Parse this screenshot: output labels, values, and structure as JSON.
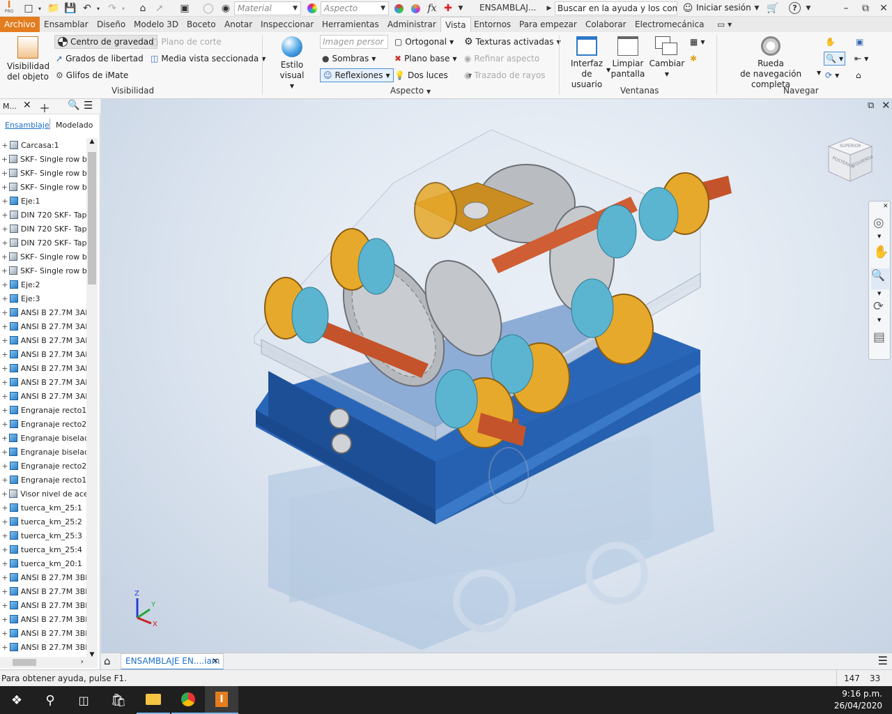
{
  "app": {
    "logo_top": "I",
    "logo_bottom": "PRO",
    "material_placeholder": "Material",
    "appearance_placeholder": "Aspecto",
    "fx": "fx",
    "doc_title": "ENSAMBLAJ...",
    "search_placeholder": "Buscar en la ayuda y los comanc",
    "signin": "Iniciar sesión",
    "help": "?"
  },
  "tabs": [
    "Archivo",
    "Ensamblar",
    "Diseño",
    "Modelo 3D",
    "Boceto",
    "Anotar",
    "Inspeccionar",
    "Herramientas",
    "Administrar",
    "Vista",
    "Entornos",
    "Para empezar",
    "Colaborar",
    "Electromecánica"
  ],
  "active_tab": "Vista",
  "ribbon": {
    "visibility": {
      "object_visibility": "Visibilidad\ndel objeto",
      "center_gravity": "Centro de gravedad",
      "cut_plane": "Plano de corte",
      "dof": "Grados de libertad",
      "half_section": "Media vista seccionada",
      "imate": "Glifos de iMate",
      "label": "Visibilidad"
    },
    "appearance": {
      "visual_style": "Estilo visual",
      "image_persp": "Imagen persor",
      "orthographic": "Ortogonal",
      "textures": "Texturas activadas",
      "shadows": "Sombras",
      "ground_plane": "Plano base",
      "refine": "Refinar aspecto",
      "reflections": "Reflexiones",
      "two_lights": "Dos luces",
      "ray_trace": "Trazado de rayos",
      "label": "Aspecto"
    },
    "windows": {
      "ui": "Interfaz de\nusuario",
      "clean": "Limpiar\npantalla",
      "switch": "Cambiar",
      "label": "Ventanas"
    },
    "navigate": {
      "wheel": "Rueda\nde navegación completa",
      "label": "Navegar"
    }
  },
  "browser": {
    "header": "M...",
    "tab_assembly": "Ensamblaje",
    "tab_modeling": "Modelado",
    "items": [
      {
        "label": "Carcasa:1",
        "type": "asm"
      },
      {
        "label": "SKF- Single row ba",
        "type": "asm"
      },
      {
        "label": "SKF- Single row ba",
        "type": "asm"
      },
      {
        "label": "SKF- Single row ba",
        "type": "asm"
      },
      {
        "label": "Eje:1",
        "type": "part"
      },
      {
        "label": "DIN 720 SKF- Tap",
        "type": "asm"
      },
      {
        "label": "DIN 720 SKF- Tap",
        "type": "asm"
      },
      {
        "label": "DIN 720 SKF- Tap",
        "type": "asm"
      },
      {
        "label": "SKF- Single row ba",
        "type": "asm"
      },
      {
        "label": "SKF- Single row ba",
        "type": "asm"
      },
      {
        "label": "Eje:2",
        "type": "part"
      },
      {
        "label": "Eje:3",
        "type": "part"
      },
      {
        "label": "ANSI B 27.7M 3AI",
        "type": "part"
      },
      {
        "label": "ANSI B 27.7M 3AI",
        "type": "part"
      },
      {
        "label": "ANSI B 27.7M 3AI",
        "type": "part"
      },
      {
        "label": "ANSI B 27.7M 3AI",
        "type": "part"
      },
      {
        "label": "ANSI B 27.7M 3AI",
        "type": "part"
      },
      {
        "label": "ANSI B 27.7M 3AI",
        "type": "part"
      },
      {
        "label": "ANSI B 27.7M 3AI",
        "type": "part"
      },
      {
        "label": "Engranaje recto1",
        "type": "part"
      },
      {
        "label": "Engranaje recto2",
        "type": "part"
      },
      {
        "label": "Engranaje biselad",
        "type": "part"
      },
      {
        "label": "Engranaje biselad",
        "type": "part"
      },
      {
        "label": "Engranaje recto2",
        "type": "part"
      },
      {
        "label": "Engranaje recto1",
        "type": "part"
      },
      {
        "label": "Visor nivel de acei",
        "type": "asm"
      },
      {
        "label": "tuerca_km_25:1",
        "type": "part"
      },
      {
        "label": "tuerca_km_25:2",
        "type": "part"
      },
      {
        "label": "tuerca_km_25:3",
        "type": "part"
      },
      {
        "label": "tuerca_km_25:4",
        "type": "part"
      },
      {
        "label": "tuerca_km_20:1",
        "type": "part"
      },
      {
        "label": "ANSI B 27.7M 3BI",
        "type": "part"
      },
      {
        "label": "ANSI B 27.7M 3BI",
        "type": "part"
      },
      {
        "label": "ANSI B 27.7M 3BI",
        "type": "part"
      },
      {
        "label": "ANSI B 27.7M 3BI",
        "type": "part"
      },
      {
        "label": "ANSI B 27.7M 3BI",
        "type": "part"
      },
      {
        "label": "ANSI B 27.7M 3BI",
        "type": "part"
      }
    ]
  },
  "viewcube": {
    "left": "POSTERIOR",
    "right": "IZQUIERDA",
    "top": "SUPERIOR"
  },
  "triad": {
    "z": "Z",
    "y": "Y",
    "x": "X"
  },
  "doc_tab": "ENSAMBLAJE EN....iam",
  "status": {
    "help": "Para obtener ayuda, pulse F1.",
    "n1": "147",
    "n2": "33"
  },
  "clock": {
    "time": "9:16 p.m.",
    "date": "26/04/2020"
  },
  "colors": {
    "file_tab": "#e37d1f",
    "housing_blue": "#1f58a8",
    "flange": "#e7a92b",
    "shaft": "#c4532c",
    "bearing": "#5bb4d0"
  }
}
